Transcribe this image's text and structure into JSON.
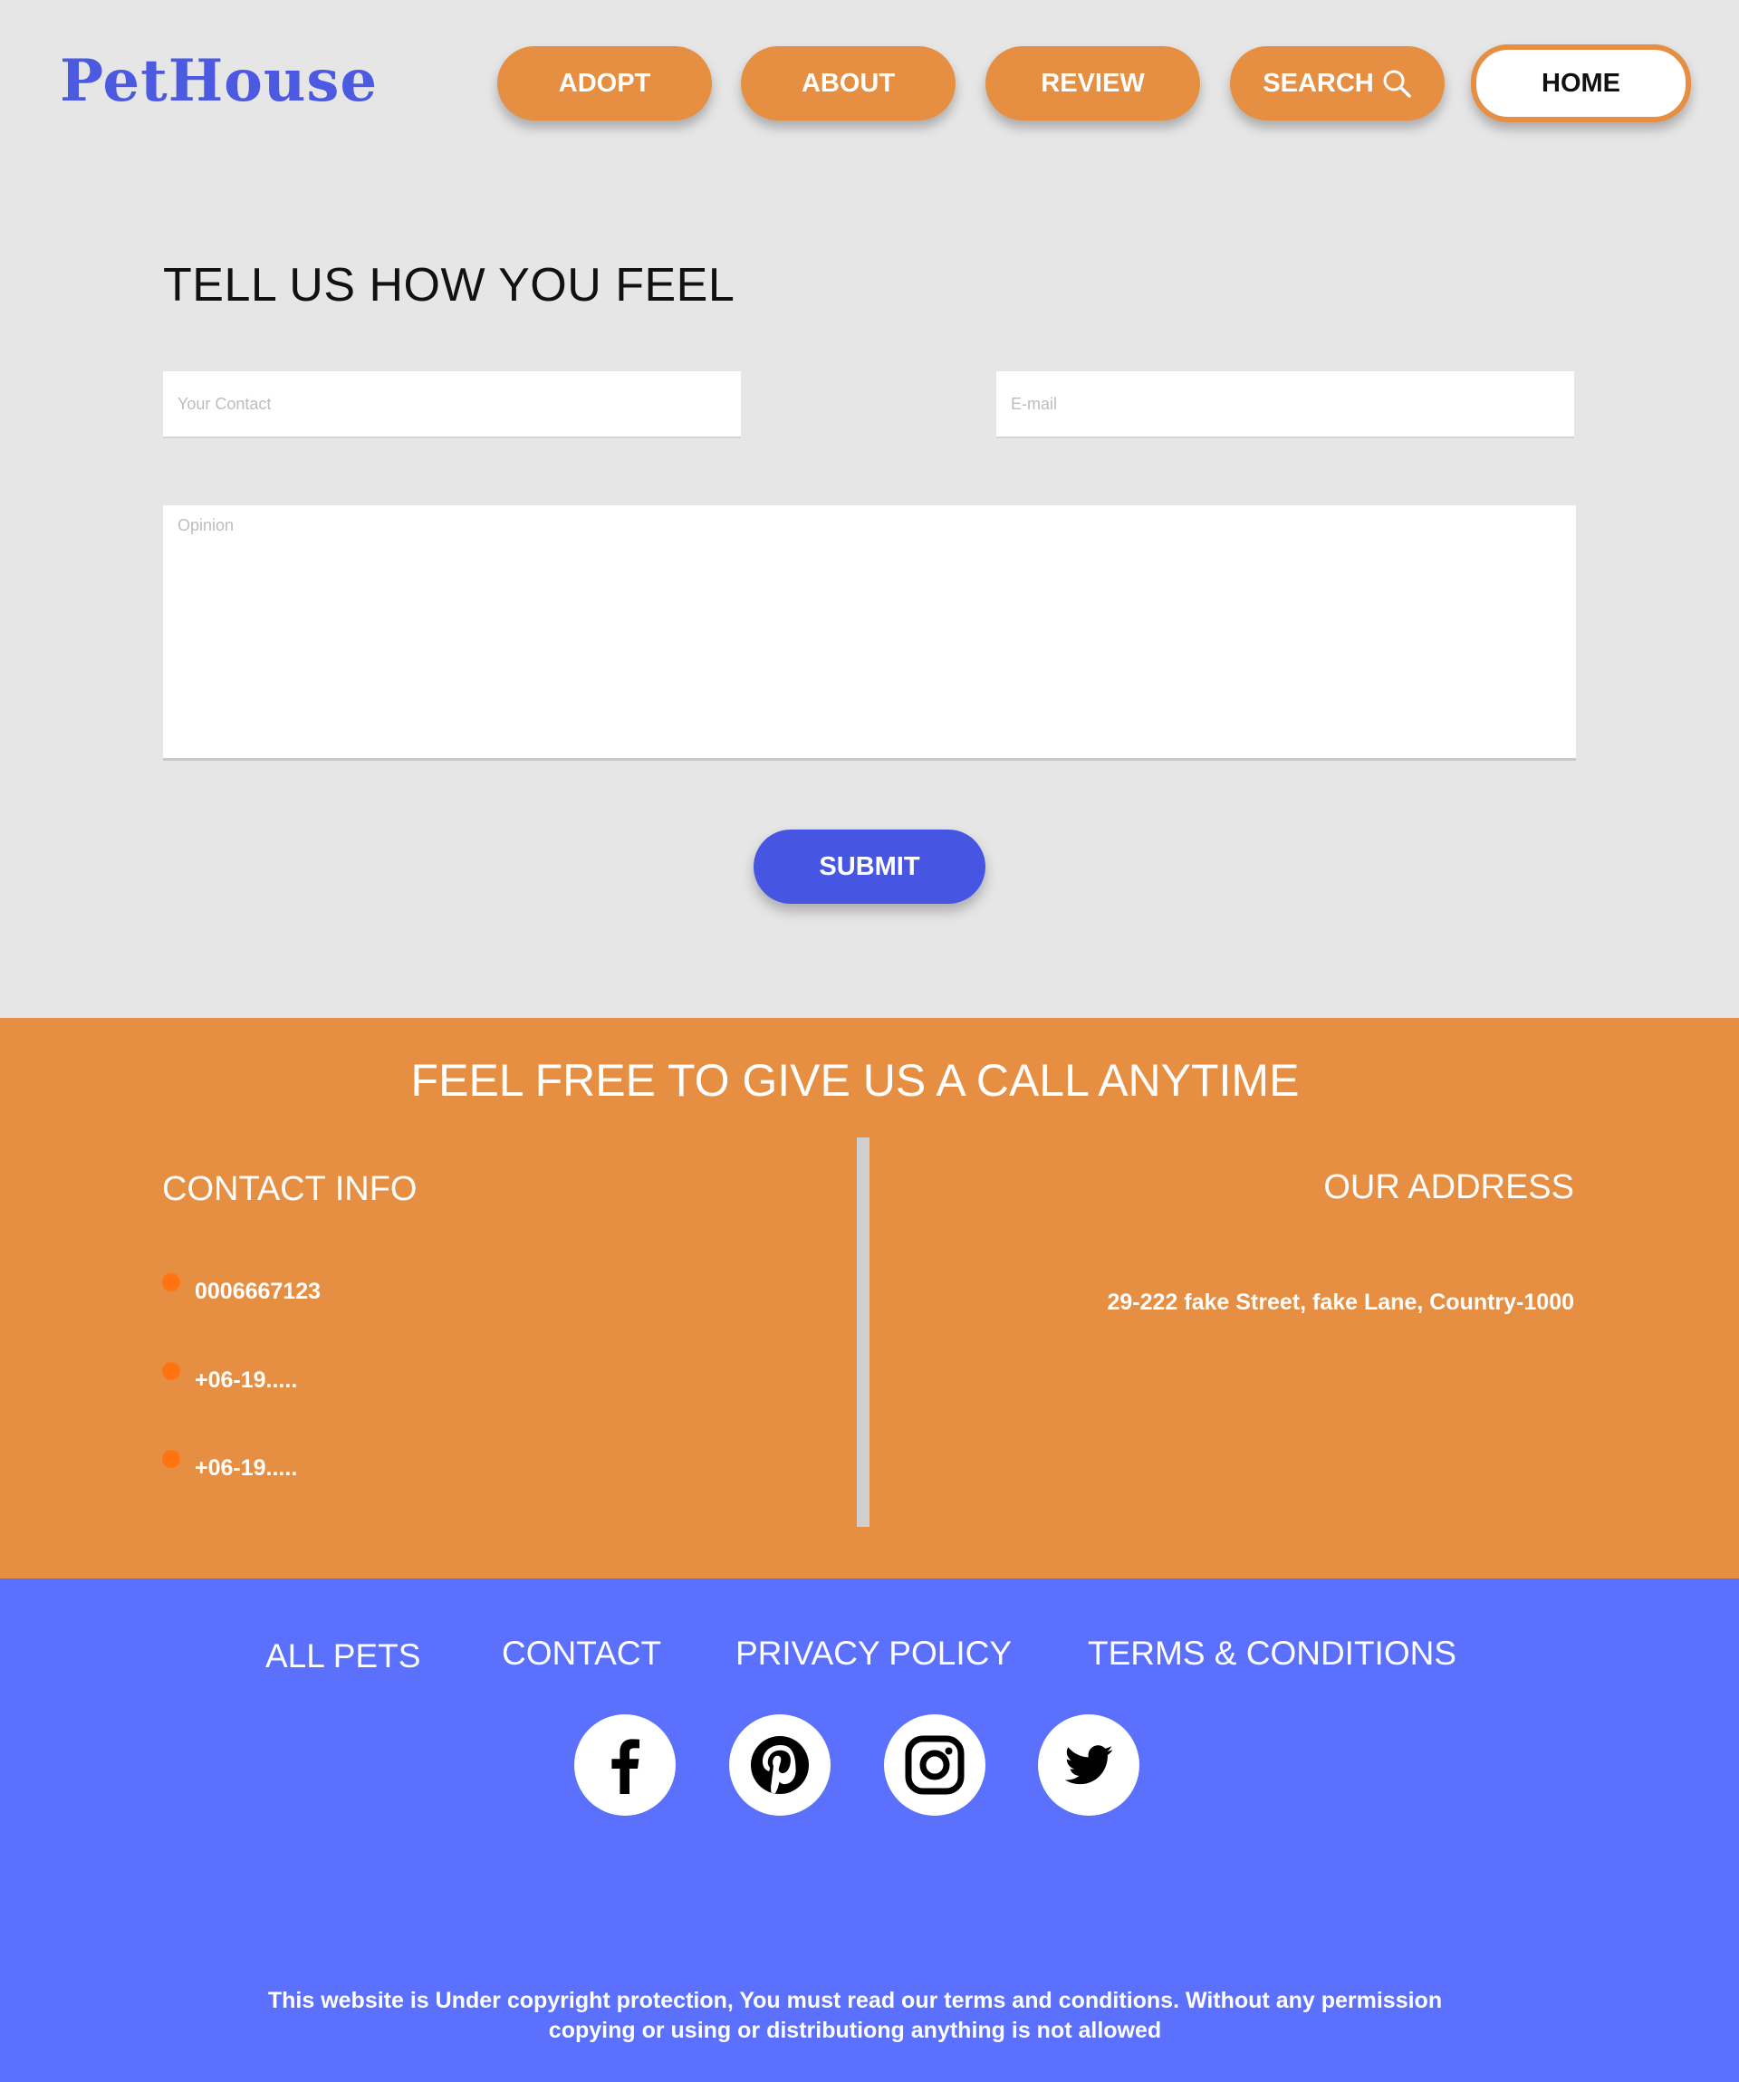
{
  "header": {
    "logo": "PetHouse",
    "nav": [
      "ADOPT",
      "ABOUT",
      "REVIEW",
      "SEARCH",
      "HOME"
    ]
  },
  "form": {
    "title": "TELL US HOW YOU FEEL",
    "contact_placeholder": "Your Contact",
    "email_placeholder": "E-mail",
    "opinion_placeholder": "Opinion",
    "submit_label": "SUBMIT"
  },
  "contact": {
    "title": "FEEL FREE TO GIVE US A CALL ANYTIME",
    "info_heading": "CONTACT INFO",
    "phones": [
      "0006667123",
      "+06-19.....",
      "+06-19....."
    ],
    "address_heading": "OUR ADDRESS",
    "address": "29-222 fake Street, fake Lane, Country-1000"
  },
  "footer": {
    "links": [
      "ALL PETS",
      "CONTACT",
      "PRIVACY POLICY",
      "TERMS & CONDITIONS"
    ],
    "social": [
      "facebook-icon",
      "pinterest-icon",
      "instagram-icon",
      "twitter-icon"
    ],
    "copyright_line1": "This website is Under copyright protection, You must read our terms and conditions. Without any permission",
    "copyright_line2": "copying or using or distributiong anything is not allowed"
  },
  "colors": {
    "background": "#e6e6e6",
    "accent_orange": "#e68f42",
    "primary_blue": "#4656e3",
    "footer_blue": "#5b70fc",
    "bullet_orange": "#ff7410",
    "logo_blue": "#4b5ae0"
  }
}
